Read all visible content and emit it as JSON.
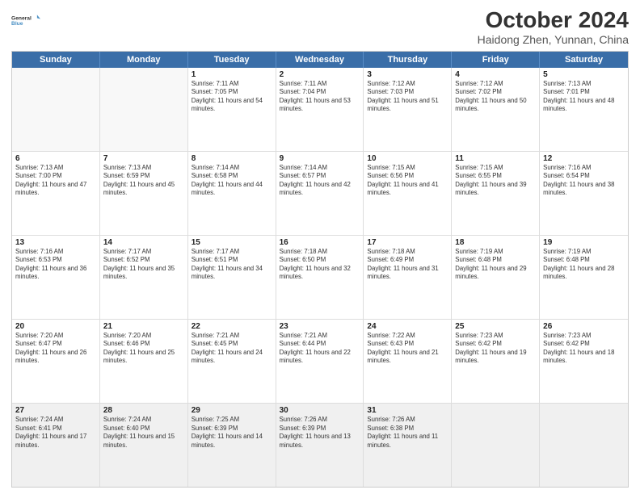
{
  "logo": {
    "line1": "General",
    "line2": "Blue"
  },
  "title": "October 2024",
  "subtitle": "Haidong Zhen, Yunnan, China",
  "weekdays": [
    "Sunday",
    "Monday",
    "Tuesday",
    "Wednesday",
    "Thursday",
    "Friday",
    "Saturday"
  ],
  "rows": [
    [
      {
        "day": "",
        "sunrise": "",
        "sunset": "",
        "daylight": "",
        "empty": true
      },
      {
        "day": "",
        "sunrise": "",
        "sunset": "",
        "daylight": "",
        "empty": true
      },
      {
        "day": "1",
        "sunrise": "Sunrise: 7:11 AM",
        "sunset": "Sunset: 7:05 PM",
        "daylight": "Daylight: 11 hours and 54 minutes."
      },
      {
        "day": "2",
        "sunrise": "Sunrise: 7:11 AM",
        "sunset": "Sunset: 7:04 PM",
        "daylight": "Daylight: 11 hours and 53 minutes."
      },
      {
        "day": "3",
        "sunrise": "Sunrise: 7:12 AM",
        "sunset": "Sunset: 7:03 PM",
        "daylight": "Daylight: 11 hours and 51 minutes."
      },
      {
        "day": "4",
        "sunrise": "Sunrise: 7:12 AM",
        "sunset": "Sunset: 7:02 PM",
        "daylight": "Daylight: 11 hours and 50 minutes."
      },
      {
        "day": "5",
        "sunrise": "Sunrise: 7:13 AM",
        "sunset": "Sunset: 7:01 PM",
        "daylight": "Daylight: 11 hours and 48 minutes."
      }
    ],
    [
      {
        "day": "6",
        "sunrise": "Sunrise: 7:13 AM",
        "sunset": "Sunset: 7:00 PM",
        "daylight": "Daylight: 11 hours and 47 minutes."
      },
      {
        "day": "7",
        "sunrise": "Sunrise: 7:13 AM",
        "sunset": "Sunset: 6:59 PM",
        "daylight": "Daylight: 11 hours and 45 minutes."
      },
      {
        "day": "8",
        "sunrise": "Sunrise: 7:14 AM",
        "sunset": "Sunset: 6:58 PM",
        "daylight": "Daylight: 11 hours and 44 minutes."
      },
      {
        "day": "9",
        "sunrise": "Sunrise: 7:14 AM",
        "sunset": "Sunset: 6:57 PM",
        "daylight": "Daylight: 11 hours and 42 minutes."
      },
      {
        "day": "10",
        "sunrise": "Sunrise: 7:15 AM",
        "sunset": "Sunset: 6:56 PM",
        "daylight": "Daylight: 11 hours and 41 minutes."
      },
      {
        "day": "11",
        "sunrise": "Sunrise: 7:15 AM",
        "sunset": "Sunset: 6:55 PM",
        "daylight": "Daylight: 11 hours and 39 minutes."
      },
      {
        "day": "12",
        "sunrise": "Sunrise: 7:16 AM",
        "sunset": "Sunset: 6:54 PM",
        "daylight": "Daylight: 11 hours and 38 minutes."
      }
    ],
    [
      {
        "day": "13",
        "sunrise": "Sunrise: 7:16 AM",
        "sunset": "Sunset: 6:53 PM",
        "daylight": "Daylight: 11 hours and 36 minutes."
      },
      {
        "day": "14",
        "sunrise": "Sunrise: 7:17 AM",
        "sunset": "Sunset: 6:52 PM",
        "daylight": "Daylight: 11 hours and 35 minutes."
      },
      {
        "day": "15",
        "sunrise": "Sunrise: 7:17 AM",
        "sunset": "Sunset: 6:51 PM",
        "daylight": "Daylight: 11 hours and 34 minutes."
      },
      {
        "day": "16",
        "sunrise": "Sunrise: 7:18 AM",
        "sunset": "Sunset: 6:50 PM",
        "daylight": "Daylight: 11 hours and 32 minutes."
      },
      {
        "day": "17",
        "sunrise": "Sunrise: 7:18 AM",
        "sunset": "Sunset: 6:49 PM",
        "daylight": "Daylight: 11 hours and 31 minutes."
      },
      {
        "day": "18",
        "sunrise": "Sunrise: 7:19 AM",
        "sunset": "Sunset: 6:48 PM",
        "daylight": "Daylight: 11 hours and 29 minutes."
      },
      {
        "day": "19",
        "sunrise": "Sunrise: 7:19 AM",
        "sunset": "Sunset: 6:48 PM",
        "daylight": "Daylight: 11 hours and 28 minutes."
      }
    ],
    [
      {
        "day": "20",
        "sunrise": "Sunrise: 7:20 AM",
        "sunset": "Sunset: 6:47 PM",
        "daylight": "Daylight: 11 hours and 26 minutes."
      },
      {
        "day": "21",
        "sunrise": "Sunrise: 7:20 AM",
        "sunset": "Sunset: 6:46 PM",
        "daylight": "Daylight: 11 hours and 25 minutes."
      },
      {
        "day": "22",
        "sunrise": "Sunrise: 7:21 AM",
        "sunset": "Sunset: 6:45 PM",
        "daylight": "Daylight: 11 hours and 24 minutes."
      },
      {
        "day": "23",
        "sunrise": "Sunrise: 7:21 AM",
        "sunset": "Sunset: 6:44 PM",
        "daylight": "Daylight: 11 hours and 22 minutes."
      },
      {
        "day": "24",
        "sunrise": "Sunrise: 7:22 AM",
        "sunset": "Sunset: 6:43 PM",
        "daylight": "Daylight: 11 hours and 21 minutes."
      },
      {
        "day": "25",
        "sunrise": "Sunrise: 7:23 AM",
        "sunset": "Sunset: 6:42 PM",
        "daylight": "Daylight: 11 hours and 19 minutes."
      },
      {
        "day": "26",
        "sunrise": "Sunrise: 7:23 AM",
        "sunset": "Sunset: 6:42 PM",
        "daylight": "Daylight: 11 hours and 18 minutes."
      }
    ],
    [
      {
        "day": "27",
        "sunrise": "Sunrise: 7:24 AM",
        "sunset": "Sunset: 6:41 PM",
        "daylight": "Daylight: 11 hours and 17 minutes."
      },
      {
        "day": "28",
        "sunrise": "Sunrise: 7:24 AM",
        "sunset": "Sunset: 6:40 PM",
        "daylight": "Daylight: 11 hours and 15 minutes."
      },
      {
        "day": "29",
        "sunrise": "Sunrise: 7:25 AM",
        "sunset": "Sunset: 6:39 PM",
        "daylight": "Daylight: 11 hours and 14 minutes."
      },
      {
        "day": "30",
        "sunrise": "Sunrise: 7:26 AM",
        "sunset": "Sunset: 6:39 PM",
        "daylight": "Daylight: 11 hours and 13 minutes."
      },
      {
        "day": "31",
        "sunrise": "Sunrise: 7:26 AM",
        "sunset": "Sunset: 6:38 PM",
        "daylight": "Daylight: 11 hours and 11 minutes."
      },
      {
        "day": "",
        "sunrise": "",
        "sunset": "",
        "daylight": "",
        "empty": true
      },
      {
        "day": "",
        "sunrise": "",
        "sunset": "",
        "daylight": "",
        "empty": true
      }
    ]
  ]
}
